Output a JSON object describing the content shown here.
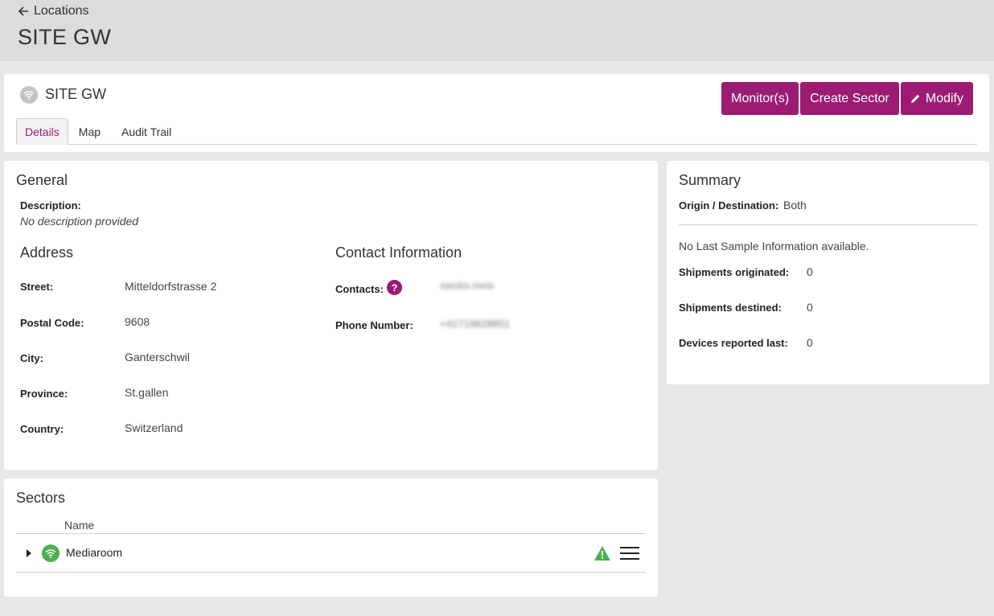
{
  "header": {
    "back_label": "Locations",
    "page_title": "SITE GW"
  },
  "site": {
    "name": "SITE GW",
    "tabs": [
      {
        "label": "Details",
        "active": true
      },
      {
        "label": "Map",
        "active": false
      },
      {
        "label": "Audit Trail",
        "active": false
      }
    ],
    "buttons": {
      "monitors": "Monitor(s)",
      "create_sector": "Create Sector",
      "modify": "Modify"
    }
  },
  "general": {
    "title": "General",
    "description_label": "Description:",
    "description_value": "No description provided"
  },
  "address": {
    "title": "Address",
    "street_label": "Street:",
    "street_value": "Mitteldorfstrasse 2",
    "postal_label": "Postal Code:",
    "postal_value": "9608",
    "city_label": "City:",
    "city_value": "Ganterschwil",
    "province_label": "Province:",
    "province_value": "St.gallen",
    "country_label": "Country:",
    "country_value": "Switzerland"
  },
  "contact": {
    "title": "Contact Information",
    "contacts_label": "Contacts:",
    "contacts_help": "?",
    "contacts_value": "sandra meta",
    "phone_label": "Phone Number:",
    "phone_value": "+41719828851"
  },
  "summary": {
    "title": "Summary",
    "origin_label": "Origin / Destination:",
    "origin_value": "Both",
    "no_sample": "No Last Sample Information available.",
    "originated_label": "Shipments originated:",
    "originated_value": "0",
    "destined_label": "Shipments destined:",
    "destined_value": "0",
    "devices_label": "Devices reported last:",
    "devices_value": "0"
  },
  "sectors": {
    "title": "Sectors",
    "column_name": "Name",
    "rows": [
      {
        "name": "Mediaroom",
        "status_icon": "wifi-icon",
        "alert_icon": "warning-icon"
      }
    ]
  },
  "colors": {
    "accent": "#9c1c74",
    "status_ok": "#4caf50"
  }
}
